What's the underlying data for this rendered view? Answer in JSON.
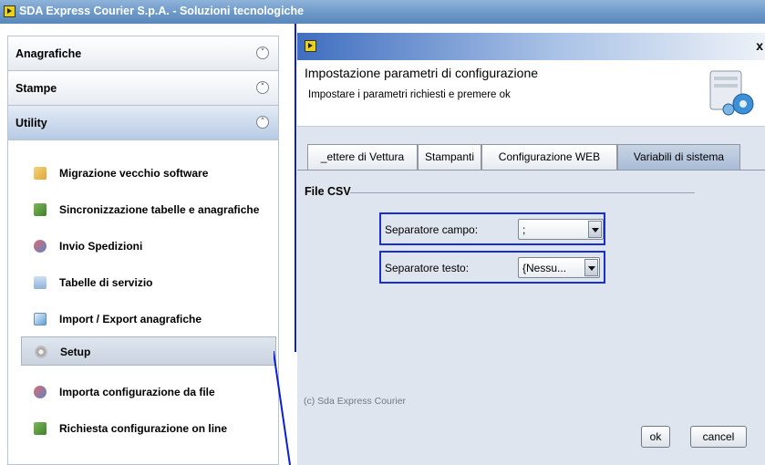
{
  "app": {
    "title": "SDA Express Courier S.p.A. - Soluzioni tecnologiche"
  },
  "sidebar": {
    "sections": [
      {
        "label": "Anagrafiche",
        "state": "collapsed"
      },
      {
        "label": "Stampe",
        "state": "collapsed"
      },
      {
        "label": "Utility",
        "state": "expanded"
      }
    ],
    "items": [
      {
        "label": "Migrazione vecchio software",
        "icon": "pencil-icon"
      },
      {
        "label": "Sincronizzazione tabelle e anagrafiche",
        "icon": "sync-icon"
      },
      {
        "label": "Invio Spedizioni",
        "icon": "send-icon"
      },
      {
        "label": "Tabelle di servizio",
        "icon": "table-icon"
      },
      {
        "label": "Import / Export anagrafiche",
        "icon": "import-export-icon"
      },
      {
        "label": "Setup",
        "icon": "gear-icon",
        "selected": true
      },
      {
        "label": "Importa configurazione da file",
        "icon": "config-icon"
      },
      {
        "label": "Richiesta configurazione on line",
        "icon": "download-icon"
      }
    ]
  },
  "dialog": {
    "close_label": "x",
    "title": "Impostazione parametri di configurazione",
    "subtitle": "Impostare i parametri richiesti e premere ok",
    "tabs": [
      {
        "label": "Lettere di Vettura",
        "visible_label": "_ettere di Vettura"
      },
      {
        "label": "Stampanti"
      },
      {
        "label": "Configurazione WEB"
      },
      {
        "label": "Variabili di sistema",
        "active": true
      }
    ],
    "group_label": "File CSV",
    "fields": [
      {
        "label": "Separatore campo:",
        "value": ";"
      },
      {
        "label": "Separatore testo:",
        "value": "{Nessu..."
      }
    ],
    "copyright": "(c) Sda Express Courier",
    "ok_label": "ok",
    "cancel_label": "cancel"
  },
  "colors": {
    "highlight_border": "#1a2fd1",
    "title_blue": "#3f6ebf"
  }
}
